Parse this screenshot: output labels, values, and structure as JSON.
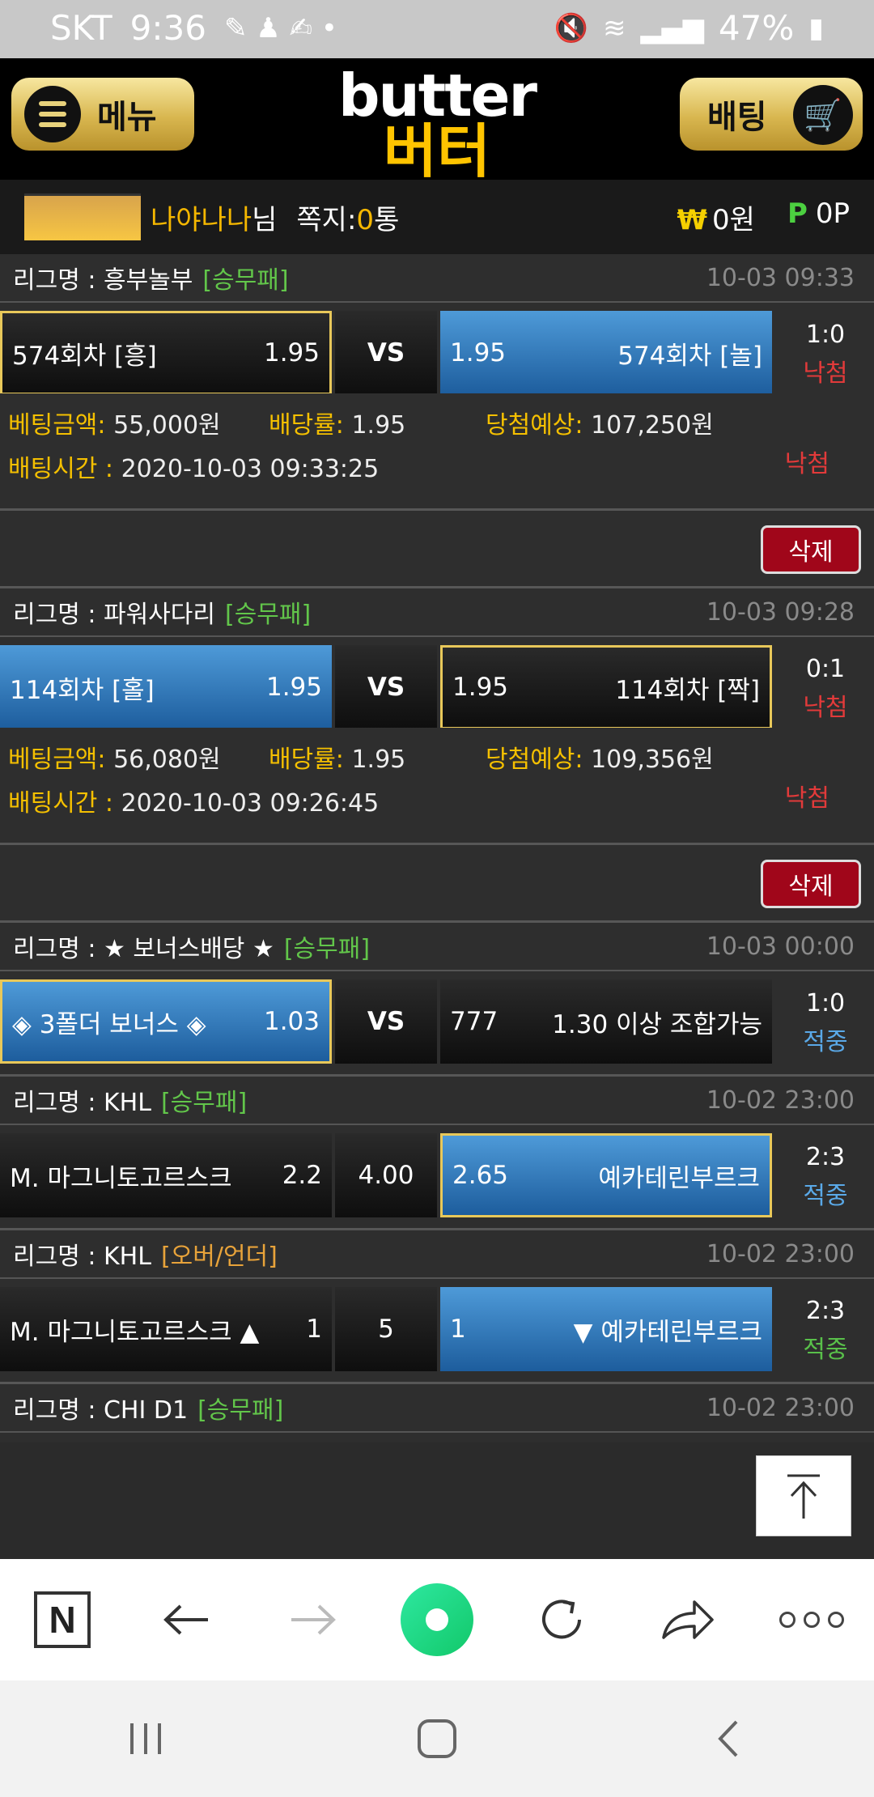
{
  "status": {
    "carrier": "SKT",
    "time": "9:36",
    "battery": "47%"
  },
  "header": {
    "menu_label": "메뉴",
    "bet_label": "배팅",
    "logo_en": "butter",
    "logo_ko": "버터"
  },
  "user": {
    "name": "나야나나",
    "honorific": "님",
    "messages_label": "쪽지:",
    "messages_count": "0",
    "messages_unit": "통",
    "won_symbol": "₩",
    "money": "0원",
    "points_symbol": "P",
    "points": "0P"
  },
  "bets": [
    {
      "league_label": "리그명 : 흥부놀부",
      "type": "[승무패]",
      "date": "10-03 09:33",
      "home": "574회차 [흥]",
      "home_odds": "1.95",
      "mid": "VS",
      "away_odds": "1.95",
      "away": "574회차 [놀]",
      "score": "1:0",
      "status": "낙첨",
      "amount_label": "베팅금액:",
      "amount": "55,000원",
      "rate_label": "배당률:",
      "rate": "1.95",
      "expect_label": "당첨예상:",
      "expect": "107,250원",
      "time_label": "배팅시간 :",
      "time": "2020-10-03 09:33:25",
      "result": "낙첨",
      "delete": "삭제"
    },
    {
      "league_label": "리그명 : 파워사다리",
      "type": "[승무패]",
      "date": "10-03 09:28",
      "home": "114회차 [홀]",
      "home_odds": "1.95",
      "mid": "VS",
      "away_odds": "1.95",
      "away": "114회차 [짝]",
      "score": "0:1",
      "status": "낙첨",
      "amount_label": "베팅금액:",
      "amount": "56,080원",
      "rate_label": "배당률:",
      "rate": "1.95",
      "expect_label": "당첨예상:",
      "expect": "109,356원",
      "time_label": "배팅시간 :",
      "time": "2020-10-03 09:26:45",
      "result": "낙첨",
      "delete": "삭제"
    }
  ],
  "multi": [
    {
      "league_label": "리그명 : ★ 보너스배당 ★",
      "type": "[승무패]",
      "date": "10-03 00:00",
      "home": "◈ 3폴더 보너스 ◈",
      "home_odds": "1.03",
      "mid": "VS",
      "away_odds": "777",
      "away": "1.30 이상 조합가능",
      "score": "1:0",
      "status": "적중"
    },
    {
      "league_label": "리그명 : KHL",
      "type": "[승무패]",
      "date": "10-02 23:00",
      "home": "M. 마그니토고르스크",
      "home_odds": "2.2",
      "mid": "4.00",
      "away_odds": "2.65",
      "away": "예카테린부르크",
      "score": "2:3",
      "status": "적중"
    },
    {
      "league_label": "리그명 : KHL",
      "type": "[오버/언더]",
      "date": "10-02 23:00",
      "home": "M. 마그니토고르스크 ▲",
      "home_odds": "1",
      "mid": "5",
      "away_odds": "1",
      "away": "▼ 예카테린부르크",
      "score": "2:3",
      "status": "적중"
    },
    {
      "league_label": "리그명 : CHI D1",
      "type": "[승무패]",
      "date": "10-02 23:00"
    }
  ]
}
